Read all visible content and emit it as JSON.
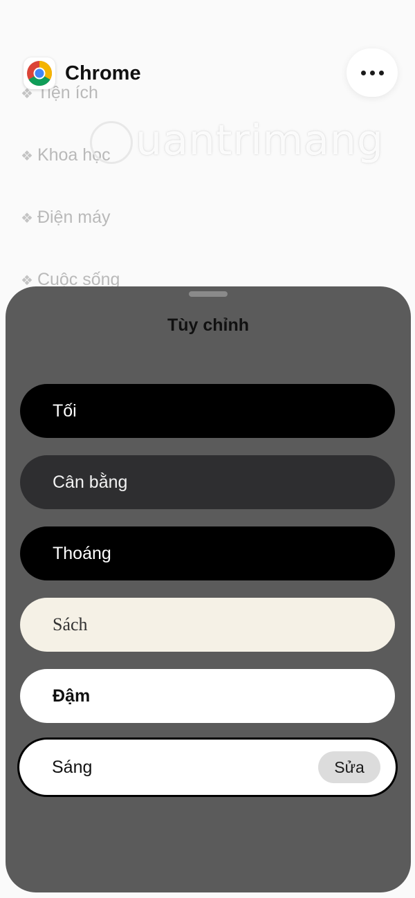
{
  "app": {
    "title": "Chrome"
  },
  "background": {
    "items": [
      "Tiện ích",
      "Khoa học",
      "Điện máy",
      "Cuộc sống"
    ],
    "watermark": "uantrimang"
  },
  "sheet": {
    "title": "Tùy chỉnh",
    "options": [
      {
        "label": "Tối"
      },
      {
        "label": "Cân bằng"
      },
      {
        "label": "Thoáng"
      },
      {
        "label": "Sách"
      },
      {
        "label": "Đậm"
      },
      {
        "label": "Sáng",
        "selected": true
      }
    ],
    "edit_label": "Sửa"
  },
  "icons": {
    "app": "chrome-logo-icon",
    "more": "more-horizontal-icon",
    "bullet": "diamond-bullet-icon"
  }
}
